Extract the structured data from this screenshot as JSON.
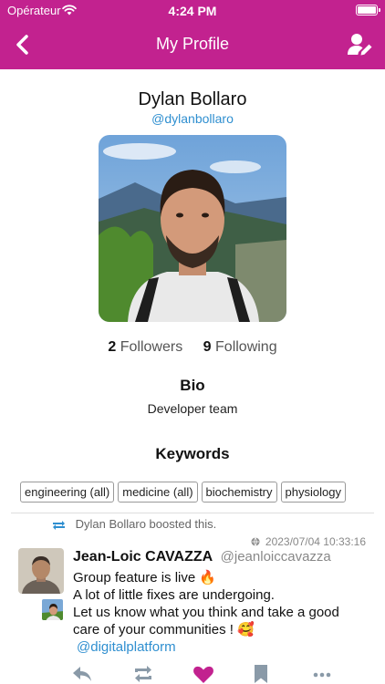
{
  "status_bar": {
    "carrier": "Opérateur",
    "time": "4:24 PM"
  },
  "nav": {
    "title": "My Profile",
    "back_icon": "chevron-left-icon",
    "edit_icon": "user-edit-icon"
  },
  "profile": {
    "name": "Dylan Bollaro",
    "handle": "@dylanbollaro",
    "followers_count": "2",
    "followers_label": "Followers",
    "following_count": "9",
    "following_label": "Following",
    "bio_heading": "Bio",
    "bio_text": "Developer team",
    "keywords_heading": "Keywords",
    "keywords": [
      "engineering (all)",
      "medicine (all)",
      "biochemistry",
      "physiology"
    ]
  },
  "post": {
    "boosted_by": "Dylan Bollaro boosted this.",
    "timestamp": "2023/07/04 10:33:16",
    "author_name": "Jean-Loic CAVAZZA",
    "author_handle": "@jeanloiccavazza",
    "lines": [
      "Group feature is live 🔥",
      "A lot of little fixes are undergoing.",
      "Let us know what you think and take a good care of your communities ! 🥰"
    ],
    "tag": "@digitalplatform"
  },
  "colors": {
    "header": "#c2228f",
    "link": "#2f8fd0",
    "action": "#8a9aa8",
    "favourite": "#c2228f"
  }
}
